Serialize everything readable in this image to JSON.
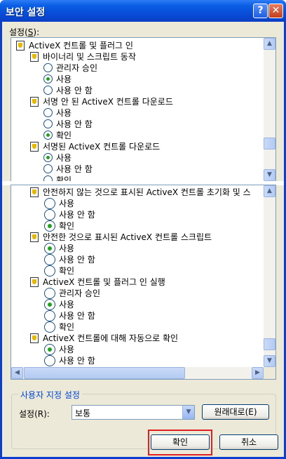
{
  "window": {
    "title": "보안 설정",
    "help_glyph": "?",
    "close_glyph": "✕"
  },
  "settings_label": {
    "text": "설정(",
    "hotkey": "S",
    "suffix": "):"
  },
  "tree_top": [
    {
      "kind": "cat",
      "label": "ActiveX 컨트롤 및 플러그 인",
      "indent": 0
    },
    {
      "kind": "cat",
      "label": "바이너리 및 스크립트 동작",
      "indent": 1
    },
    {
      "kind": "radio",
      "label": "관리자 승인",
      "checked": false
    },
    {
      "kind": "radio",
      "label": "사용",
      "checked": true
    },
    {
      "kind": "radio",
      "label": "사용 안 함",
      "checked": false
    },
    {
      "kind": "cat",
      "label": "서명 안 된 ActiveX 컨트롤 다운로드",
      "indent": 1
    },
    {
      "kind": "radio",
      "label": "사용",
      "checked": false
    },
    {
      "kind": "radio",
      "label": "사용 안 함",
      "checked": false
    },
    {
      "kind": "radio",
      "label": "확인",
      "checked": true
    },
    {
      "kind": "cat",
      "label": "서명된 ActiveX 컨트롤 다운로드",
      "indent": 1
    },
    {
      "kind": "radio",
      "label": "사용",
      "checked": true
    },
    {
      "kind": "radio",
      "label": "사용 안 함",
      "checked": false
    },
    {
      "kind": "radio",
      "label": "확인",
      "checked": false
    }
  ],
  "tree_bottom": [
    {
      "kind": "cat",
      "label": "안전하지 않는 것으로 표시된 ActiveX 컨트롤 초기화 및 스"
    },
    {
      "kind": "radio",
      "label": "사용",
      "checked": false
    },
    {
      "kind": "radio",
      "label": "사용 안 함",
      "checked": false
    },
    {
      "kind": "radio",
      "label": "확인",
      "checked": true
    },
    {
      "kind": "cat",
      "label": "안전한 것으로 표시된 ActiveX 컨트롤 스크립트"
    },
    {
      "kind": "radio",
      "label": "사용",
      "checked": true
    },
    {
      "kind": "radio",
      "label": "사용 안 함",
      "checked": false
    },
    {
      "kind": "radio",
      "label": "확인",
      "checked": false
    },
    {
      "kind": "cat",
      "label": "ActiveX 컨트롤 및 플러그 인 실행"
    },
    {
      "kind": "radio",
      "label": "관리자 승인",
      "checked": false
    },
    {
      "kind": "radio",
      "label": "사용",
      "checked": true
    },
    {
      "kind": "radio",
      "label": "사용 안 함",
      "checked": false
    },
    {
      "kind": "radio",
      "label": "확인",
      "checked": false
    },
    {
      "kind": "cat",
      "label": "ActiveX 컨트롤에 대해 자동으로 확인"
    },
    {
      "kind": "radio",
      "label": "사용",
      "checked": true
    },
    {
      "kind": "radio",
      "label": "사용 안 함",
      "checked": false
    }
  ],
  "custom_group": {
    "title": "사용자 지정 설정",
    "level_label": "설정(R):",
    "level_value": "보통",
    "reset_button": "원래대로(E)"
  },
  "buttons": {
    "ok": "확인",
    "cancel": "취소"
  },
  "colors": {
    "titlebar": "#0a5fe4",
    "dialog_bg": "#ece9d8",
    "group_title": "#0046d5",
    "radio_dot": "#21a121",
    "highlight": "#e02020"
  },
  "icons": {
    "scroll_up": "▲",
    "scroll_down": "▼",
    "scroll_left": "◀",
    "scroll_right": "▶",
    "dropdown": "▼"
  }
}
